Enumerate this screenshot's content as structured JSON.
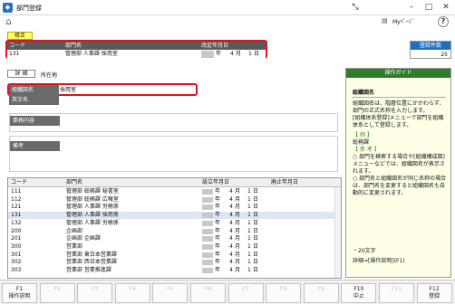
{
  "window": {
    "title": "部門登録"
  },
  "toolbar": {
    "mypage_label": "Myﾍﾟｰｼﾞ"
  },
  "mode_badge": "修正",
  "header": {
    "columns": {
      "code": "コード",
      "name": "部門名",
      "revised": "改定年月日"
    },
    "values": {
      "code": "131",
      "name": "管理部 人事課 採用室",
      "year_label": "年",
      "month": "4",
      "month_label": "月",
      "day": "1",
      "day_label": "日"
    }
  },
  "registered_count": {
    "label": "登録件数",
    "value": "25"
  },
  "tabs": {
    "detail": "詳 細",
    "location": "所在地"
  },
  "form": {
    "org_name_label": "組織図名",
    "org_name_value": "採用室",
    "english_label": "英字名",
    "business_label": "業務内容",
    "remarks_label": "備考"
  },
  "guide": {
    "header": "操作ガイド",
    "title": "組織図名",
    "body": "組織図名は、階層位置にかかわらず、部門の正式名称を入力します。\n[組織体系登録]メニューで部門を組織体系として登録します。",
    "example_title": "【 例 】",
    "example": "総務課",
    "ref_title": "【 参 考 】",
    "ref1": "○ 部門を検索する場合や[組織構成図]メニューなどでは、組織図名が表示されます。",
    "ref2": "○ 部門名と組織図名が同じ名称の場合は、部門名を変更すると組織図名も自動的に変更されます。",
    "footer1": "・20文字",
    "footer2": "詳細⇒[操作説明](F1)"
  },
  "table": {
    "headers": {
      "code": "コード",
      "name": "部門名",
      "established": "設立年月日",
      "abolished": "廃止年月日"
    },
    "rows": [
      {
        "code": "111",
        "name": "管理部 総務課 秘書室",
        "month": "4",
        "day": "1"
      },
      {
        "code": "112",
        "name": "管理部 総務課 広報室",
        "month": "4",
        "day": "1"
      },
      {
        "code": "121",
        "name": "管理部 人事課 労務係",
        "month": "4",
        "day": "1"
      },
      {
        "code": "131",
        "name": "管理部 人事課 採用係",
        "month": "4",
        "day": "1"
      },
      {
        "code": "132",
        "name": "管理部 人事課 労務係",
        "month": "4",
        "day": "1"
      },
      {
        "code": "200",
        "name": "企画部",
        "month": "4",
        "day": "1"
      },
      {
        "code": "201",
        "name": "企画部 企画課",
        "month": "4",
        "day": "1"
      },
      {
        "code": "300",
        "name": "営業部",
        "month": "4",
        "day": "1"
      },
      {
        "code": "301",
        "name": "営業部 東日本営業課",
        "month": "4",
        "day": "1"
      },
      {
        "code": "302",
        "name": "営業部 西日本営業課",
        "month": "4",
        "day": "1"
      },
      {
        "code": "303",
        "name": "営業部 営業推進課",
        "month": "4",
        "day": "1"
      }
    ],
    "year_label": "年",
    "month_label": "月",
    "day_label": "日"
  },
  "fkeys": [
    {
      "key": "F1",
      "label": "操作説明",
      "enabled": true
    },
    {
      "key": "F2",
      "label": "",
      "enabled": false
    },
    {
      "key": "F3",
      "label": "",
      "enabled": false
    },
    {
      "key": "F4",
      "label": "",
      "enabled": false
    },
    {
      "key": "F5",
      "label": "",
      "enabled": false
    },
    {
      "key": "F6",
      "label": "",
      "enabled": false
    },
    {
      "key": "F7",
      "label": "",
      "enabled": false
    },
    {
      "key": "F8",
      "label": "",
      "enabled": false
    },
    {
      "key": "F9",
      "label": "",
      "enabled": false
    },
    {
      "key": "F10",
      "label": "中止",
      "enabled": true
    },
    {
      "key": "F11",
      "label": "",
      "enabled": false
    },
    {
      "key": "F12",
      "label": "登録",
      "enabled": true
    }
  ]
}
